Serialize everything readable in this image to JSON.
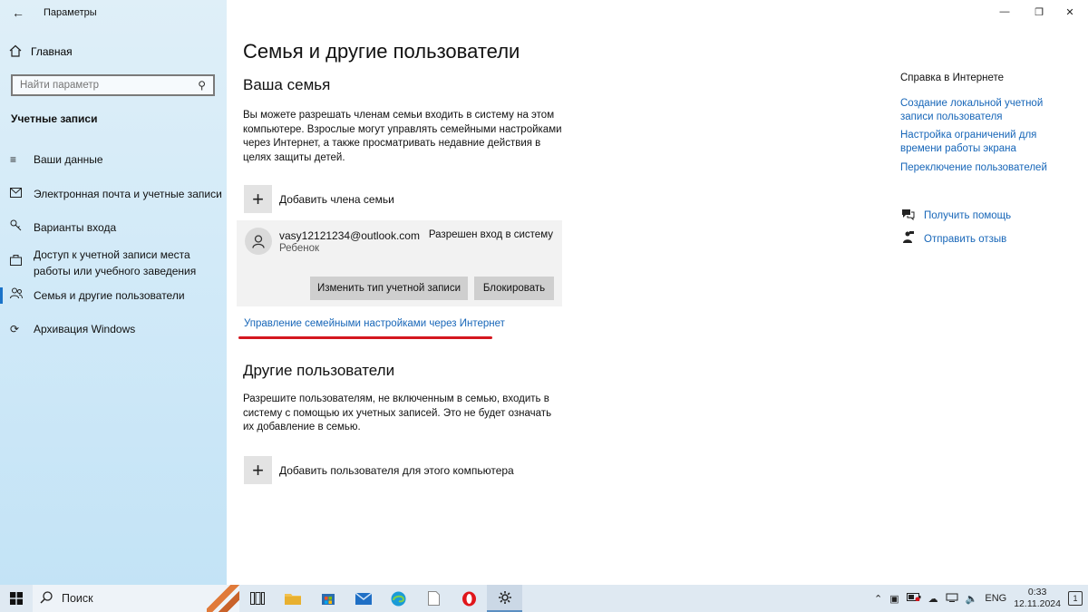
{
  "window": {
    "title": "Параметры",
    "back_icon": "back-arrow-icon"
  },
  "sidebar": {
    "home_label": "Главная",
    "search_placeholder": "Найти параметр",
    "section_title": "Учетные записи",
    "items": [
      {
        "label": "Ваши данные",
        "icon": "user-list-icon"
      },
      {
        "label": "Электронная почта и учетные записи",
        "icon": "mail-icon"
      },
      {
        "label": "Варианты входа",
        "icon": "key-icon"
      },
      {
        "label": "Доступ к учетной записи места работы или учебного заведения",
        "icon": "briefcase-icon"
      },
      {
        "label": "Семья и другие пользователи",
        "icon": "people-icon",
        "active": true
      },
      {
        "label": "Архивация Windows",
        "icon": "sync-icon"
      }
    ]
  },
  "main": {
    "title": "Семья и другие пользователи",
    "family": {
      "heading": "Ваша семья",
      "description": "Вы можете разрешать членам семьи входить в систему на этом компьютере. Взрослые могут управлять семейными настройками через Интернет, а также просматривать недавние действия в целях защиты детей.",
      "add_label": "Добавить члена семьи",
      "member": {
        "email": "vasy12121234@outlook.com",
        "role": "Ребенок",
        "status": "Разрешен вход в систему",
        "change_type_button": "Изменить тип учетной записи",
        "block_button": "Блокировать"
      },
      "manage_link": "Управление семейными настройками через Интернет"
    },
    "others": {
      "heading": "Другие пользователи",
      "description": "Разрешите пользователям, не включенным в семью, входить в систему с помощью их учетных записей. Это не будет означать их добавление в семью.",
      "add_label": "Добавить пользователя для этого компьютера"
    }
  },
  "help": {
    "title": "Справка в Интернете",
    "links": [
      "Создание локальной учетной записи пользователя",
      "Настройка ограничений для времени работы экрана",
      "Переключение пользователей"
    ],
    "get_help": "Получить помощь",
    "feedback": "Отправить отзыв"
  },
  "taskbar": {
    "search_label": "Поиск",
    "language": "ENG",
    "time": "0:33",
    "date": "12.11.2024",
    "notifications": "1"
  },
  "colors": {
    "accent": "#1766b8",
    "highlight_underline": "#d4171f",
    "sidebar_bg": "#d2eaf8"
  }
}
